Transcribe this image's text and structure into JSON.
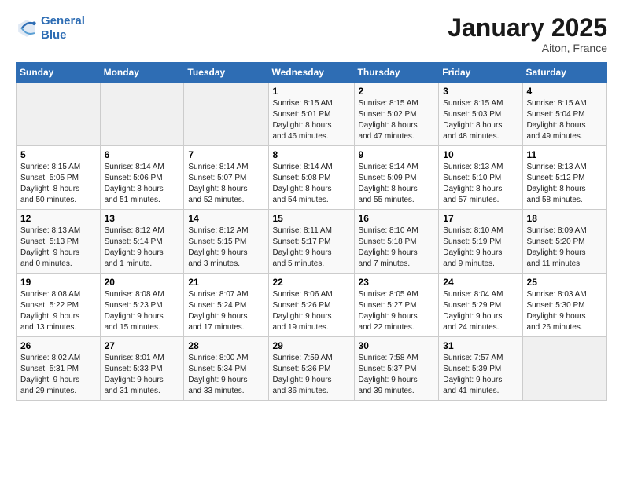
{
  "logo": {
    "line1": "General",
    "line2": "Blue"
  },
  "title": "January 2025",
  "subtitle": "Aiton, France",
  "weekdays": [
    "Sunday",
    "Monday",
    "Tuesday",
    "Wednesday",
    "Thursday",
    "Friday",
    "Saturday"
  ],
  "weeks": [
    [
      {
        "day": "",
        "info": ""
      },
      {
        "day": "",
        "info": ""
      },
      {
        "day": "",
        "info": ""
      },
      {
        "day": "1",
        "info": "Sunrise: 8:15 AM\nSunset: 5:01 PM\nDaylight: 8 hours\nand 46 minutes."
      },
      {
        "day": "2",
        "info": "Sunrise: 8:15 AM\nSunset: 5:02 PM\nDaylight: 8 hours\nand 47 minutes."
      },
      {
        "day": "3",
        "info": "Sunrise: 8:15 AM\nSunset: 5:03 PM\nDaylight: 8 hours\nand 48 minutes."
      },
      {
        "day": "4",
        "info": "Sunrise: 8:15 AM\nSunset: 5:04 PM\nDaylight: 8 hours\nand 49 minutes."
      }
    ],
    [
      {
        "day": "5",
        "info": "Sunrise: 8:15 AM\nSunset: 5:05 PM\nDaylight: 8 hours\nand 50 minutes."
      },
      {
        "day": "6",
        "info": "Sunrise: 8:14 AM\nSunset: 5:06 PM\nDaylight: 8 hours\nand 51 minutes."
      },
      {
        "day": "7",
        "info": "Sunrise: 8:14 AM\nSunset: 5:07 PM\nDaylight: 8 hours\nand 52 minutes."
      },
      {
        "day": "8",
        "info": "Sunrise: 8:14 AM\nSunset: 5:08 PM\nDaylight: 8 hours\nand 54 minutes."
      },
      {
        "day": "9",
        "info": "Sunrise: 8:14 AM\nSunset: 5:09 PM\nDaylight: 8 hours\nand 55 minutes."
      },
      {
        "day": "10",
        "info": "Sunrise: 8:13 AM\nSunset: 5:10 PM\nDaylight: 8 hours\nand 57 minutes."
      },
      {
        "day": "11",
        "info": "Sunrise: 8:13 AM\nSunset: 5:12 PM\nDaylight: 8 hours\nand 58 minutes."
      }
    ],
    [
      {
        "day": "12",
        "info": "Sunrise: 8:13 AM\nSunset: 5:13 PM\nDaylight: 9 hours\nand 0 minutes."
      },
      {
        "day": "13",
        "info": "Sunrise: 8:12 AM\nSunset: 5:14 PM\nDaylight: 9 hours\nand 1 minute."
      },
      {
        "day": "14",
        "info": "Sunrise: 8:12 AM\nSunset: 5:15 PM\nDaylight: 9 hours\nand 3 minutes."
      },
      {
        "day": "15",
        "info": "Sunrise: 8:11 AM\nSunset: 5:17 PM\nDaylight: 9 hours\nand 5 minutes."
      },
      {
        "day": "16",
        "info": "Sunrise: 8:10 AM\nSunset: 5:18 PM\nDaylight: 9 hours\nand 7 minutes."
      },
      {
        "day": "17",
        "info": "Sunrise: 8:10 AM\nSunset: 5:19 PM\nDaylight: 9 hours\nand 9 minutes."
      },
      {
        "day": "18",
        "info": "Sunrise: 8:09 AM\nSunset: 5:20 PM\nDaylight: 9 hours\nand 11 minutes."
      }
    ],
    [
      {
        "day": "19",
        "info": "Sunrise: 8:08 AM\nSunset: 5:22 PM\nDaylight: 9 hours\nand 13 minutes."
      },
      {
        "day": "20",
        "info": "Sunrise: 8:08 AM\nSunset: 5:23 PM\nDaylight: 9 hours\nand 15 minutes."
      },
      {
        "day": "21",
        "info": "Sunrise: 8:07 AM\nSunset: 5:24 PM\nDaylight: 9 hours\nand 17 minutes."
      },
      {
        "day": "22",
        "info": "Sunrise: 8:06 AM\nSunset: 5:26 PM\nDaylight: 9 hours\nand 19 minutes."
      },
      {
        "day": "23",
        "info": "Sunrise: 8:05 AM\nSunset: 5:27 PM\nDaylight: 9 hours\nand 22 minutes."
      },
      {
        "day": "24",
        "info": "Sunrise: 8:04 AM\nSunset: 5:29 PM\nDaylight: 9 hours\nand 24 minutes."
      },
      {
        "day": "25",
        "info": "Sunrise: 8:03 AM\nSunset: 5:30 PM\nDaylight: 9 hours\nand 26 minutes."
      }
    ],
    [
      {
        "day": "26",
        "info": "Sunrise: 8:02 AM\nSunset: 5:31 PM\nDaylight: 9 hours\nand 29 minutes."
      },
      {
        "day": "27",
        "info": "Sunrise: 8:01 AM\nSunset: 5:33 PM\nDaylight: 9 hours\nand 31 minutes."
      },
      {
        "day": "28",
        "info": "Sunrise: 8:00 AM\nSunset: 5:34 PM\nDaylight: 9 hours\nand 33 minutes."
      },
      {
        "day": "29",
        "info": "Sunrise: 7:59 AM\nSunset: 5:36 PM\nDaylight: 9 hours\nand 36 minutes."
      },
      {
        "day": "30",
        "info": "Sunrise: 7:58 AM\nSunset: 5:37 PM\nDaylight: 9 hours\nand 39 minutes."
      },
      {
        "day": "31",
        "info": "Sunrise: 7:57 AM\nSunset: 5:39 PM\nDaylight: 9 hours\nand 41 minutes."
      },
      {
        "day": "",
        "info": ""
      }
    ]
  ]
}
